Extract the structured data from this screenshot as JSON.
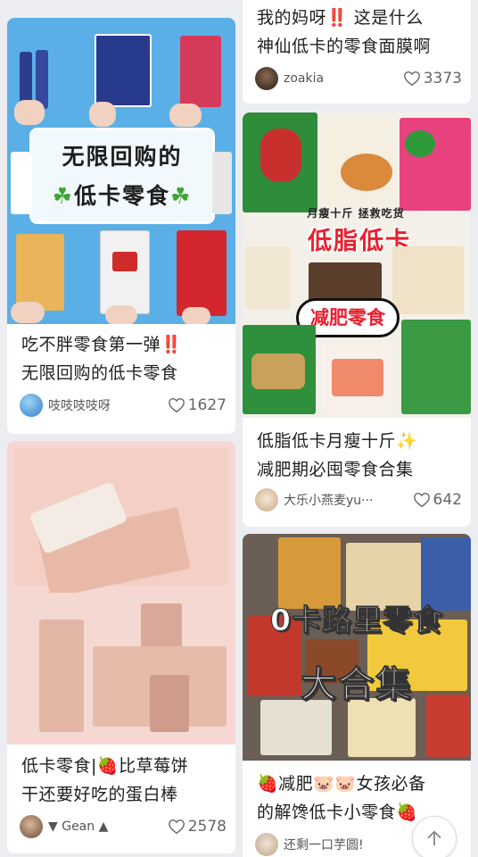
{
  "feed": {
    "cards": [
      {
        "title_line1": "我的妈呀‼️ 这是什么",
        "title_line2": "神仙低卡的零食面膜啊",
        "author": "zoakia",
        "likes": "3373"
      },
      {
        "image_text_main": "无限回购的",
        "image_text_sub": "低卡零食",
        "title_line1": "吃不胖零食第一弹",
        "title_line2": "无限回购的低卡零食",
        "author": "吱吱吱吱呀",
        "likes": "1627"
      },
      {
        "image_text_top": "月瘦十斤   拯救吃货",
        "image_text_main": "低脂低卡",
        "image_text_bubble": "减肥零食",
        "title_line1": "低脂低卡月瘦十斤",
        "title_line2": "减肥期必囤零食合集",
        "author": "大乐小燕麦yu···",
        "likes": "642"
      },
      {
        "title_line1": "低卡零食|",
        "title_line1b": "比草莓饼",
        "title_line2": "干还要好吃的蛋白棒",
        "author": "▼ Gean ▲",
        "likes": "2578"
      },
      {
        "image_text_main": "0卡路里零食",
        "image_text_sub": "大合集",
        "title_line1": "减肥",
        "title_line1b": "女孩必备",
        "title_line2": "的解馋低卡小零食",
        "author": "还剩一口芋圆!"
      }
    ]
  },
  "icons": {
    "like": "heart-outline-icon",
    "back_to_top": "arrow-up-icon"
  },
  "colors": {
    "background": "#ecedf1",
    "card": "#ffffff",
    "title_text": "#1e1e1e",
    "meta_text": "#555555"
  }
}
